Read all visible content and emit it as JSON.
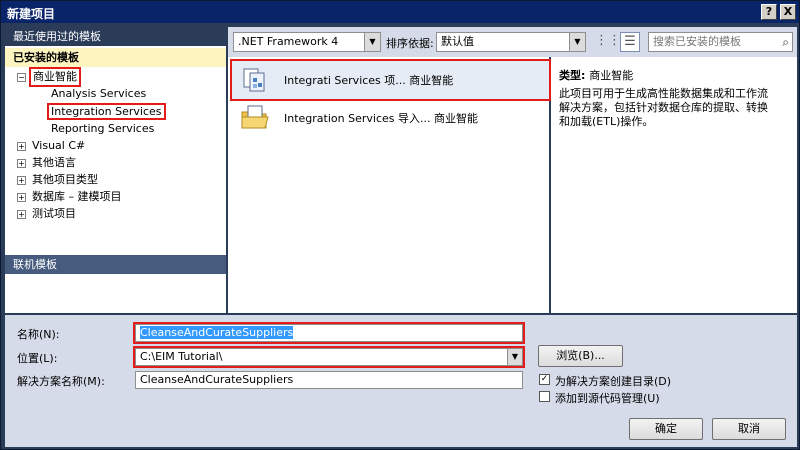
{
  "window": {
    "title": "新建项目",
    "help_label": "?",
    "close_label": "X"
  },
  "left": {
    "recent_header": "最近使用过的模板",
    "installed_header": "已安装的模板",
    "online_header": "联机模板",
    "tree": [
      {
        "label": "商业智能",
        "expander": "−",
        "level": 0
      },
      {
        "label": "Analysis Services",
        "level": 1
      },
      {
        "label": "Integration Services",
        "level": 1
      },
      {
        "label": "Reporting Services",
        "level": 1
      },
      {
        "label": "Visual C#",
        "expander": "+",
        "level": 0
      },
      {
        "label": "其他语言",
        "expander": "+",
        "level": 0
      },
      {
        "label": "其他项目类型",
        "expander": "+",
        "level": 0
      },
      {
        "label": "数据库 – 建模项目",
        "expander": "+",
        "level": 0
      },
      {
        "label": "测试项目",
        "expander": "+",
        "level": 0
      }
    ]
  },
  "toolbar": {
    "framework": ".NET Framework 4",
    "sort_label": "排序依据:",
    "sort_value": "默认值",
    "search_placeholder": "搜索已安装的模板"
  },
  "templates": [
    {
      "name": "Integrati Services 项...  商业智能",
      "icon": "ssis-project-icon",
      "selected": true
    },
    {
      "name": "Integration Services 导入...  商业智能",
      "icon": "folder-import-icon",
      "selected": false
    }
  ],
  "description": {
    "type_label": "类型:",
    "type_value": "商业智能",
    "text": "此项目可用于生成高性能数据集成和工作流解决方案，包括针对数据仓库的提取、转换和加载(ETL)操作。"
  },
  "form": {
    "name_label": "名称(N):",
    "name_value": "CleanseAndCurateSuppliers",
    "location_label": "位置(L):",
    "location_value": "C:\\EIM Tutorial\\",
    "solution_label": "解决方案名称(M):",
    "solution_value": "CleanseAndCurateSuppliers",
    "browse_label": "浏览(B)...",
    "create_dir_label": "为解决方案创建目录(D)",
    "create_dir_checked": true,
    "source_control_label": "添加到源代码管理(U)",
    "source_control_checked": false,
    "ok_label": "确定",
    "cancel_label": "取消"
  },
  "colors": {
    "frame": "#2b3c59",
    "highlight": "#e21b1b",
    "installed_bg": "#fdf4bf",
    "panel": "#d6dbe9"
  }
}
